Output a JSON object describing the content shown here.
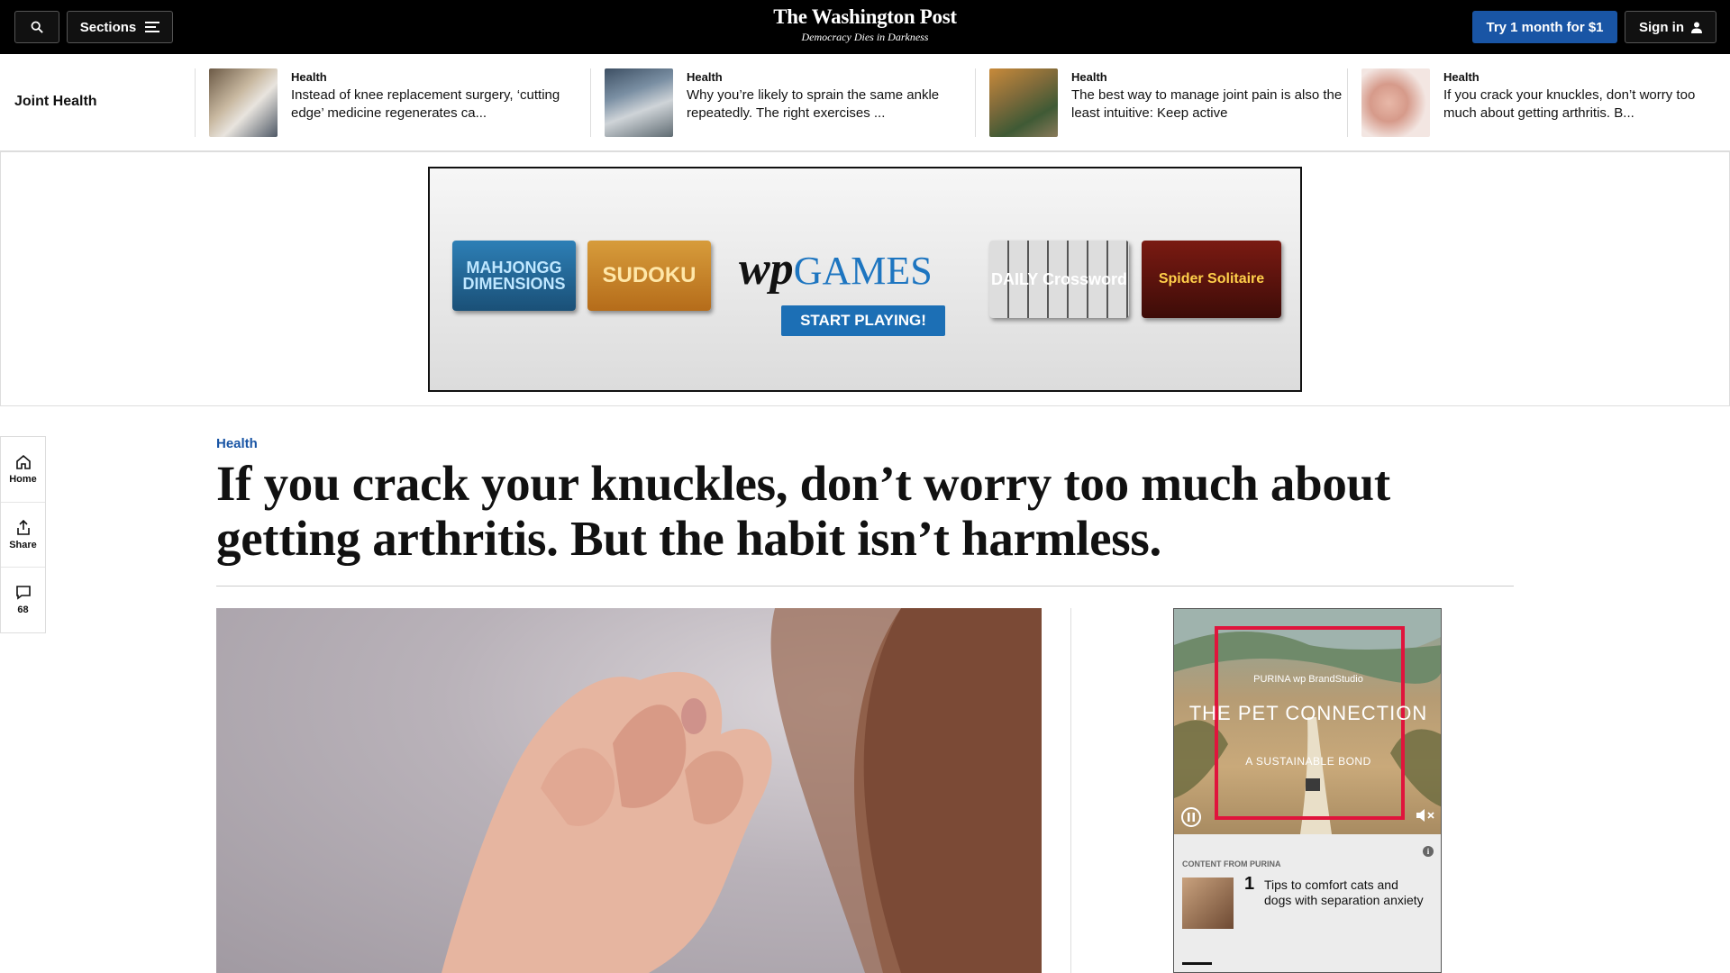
{
  "topbar": {
    "sections_label": "Sections",
    "logo_name": "The Washington Post",
    "logo_tagline": "Democracy Dies in Darkness",
    "try_label": "Try 1 month for $1",
    "signin_label": "Sign in"
  },
  "strip": {
    "label": "Joint Health",
    "stories": [
      {
        "kicker": "Health",
        "headline": "Instead of knee replacement surgery, ‘cutting edge’ medicine regenerates ca..."
      },
      {
        "kicker": "Health",
        "headline": "Why you’re likely to sprain the same ankle repeatedly. The right exercises ..."
      },
      {
        "kicker": "Health",
        "headline": "The best way to manage joint pain is also the least intuitive: Keep active"
      },
      {
        "kicker": "Health",
        "headline": "If you crack your knuckles, don’t worry too much about getting arthritis. B..."
      }
    ]
  },
  "ad": {
    "tile1": "MAHJONGG DIMENSIONS",
    "tile2": "SUDOKU",
    "brand_wp": "wp",
    "brand_games": "GAMES",
    "cta": "START PLAYING!",
    "tile3": "DAILY Crossword",
    "tile4": "Spider Solitaire"
  },
  "rail": {
    "home": "Home",
    "share": "Share",
    "comments": "68"
  },
  "article": {
    "kicker": "Health",
    "headline": "If you crack your knuckles, don’t worry too much about getting arthritis. But the habit isn’t harmless."
  },
  "purina": {
    "brand": "PURINA   wp BrandStudio",
    "title": "THE PET CONNECTION",
    "subtitle": "A SUSTAINABLE BOND",
    "content_from": "CONTENT FROM PURINA",
    "tip_number": "1",
    "tip_text": "Tips to comfort cats and dogs with separation anxiety"
  }
}
